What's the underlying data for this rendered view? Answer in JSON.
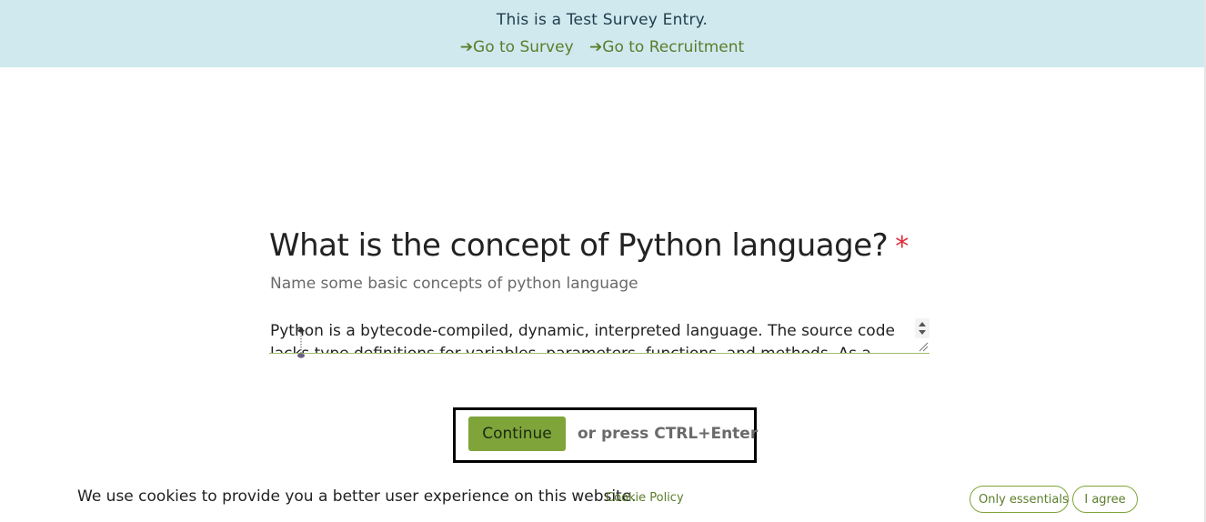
{
  "banner": {
    "title": "This is a Test Survey Entry.",
    "links": [
      {
        "label": "➔Go to Survey"
      },
      {
        "label": "➔Go to Recruitment"
      }
    ],
    "background": "#d0e9ef"
  },
  "question": {
    "title": "What is the concept of Python language?",
    "required_marker": "*",
    "hint": "Name some basic concepts of python language"
  },
  "answer": {
    "value": "Python is a bytecode-compiled, dynamic, interpreted language. The source code lacks type definitions for variables, parameters, functions, and methods. As a result, the code"
  },
  "actions": {
    "continue_label": "Continue",
    "shortcut_hint": "or press CTRL+Enter"
  },
  "cookies": {
    "message": "We use cookies to provide you a better user experience on this website.",
    "policy_link": "Cookie Policy",
    "only_essentials_label": "Only essentials",
    "agree_label": "I agree"
  },
  "colors": {
    "accent": "#7fa43a",
    "link": "#5b7d2a",
    "required": "#e0293a"
  }
}
